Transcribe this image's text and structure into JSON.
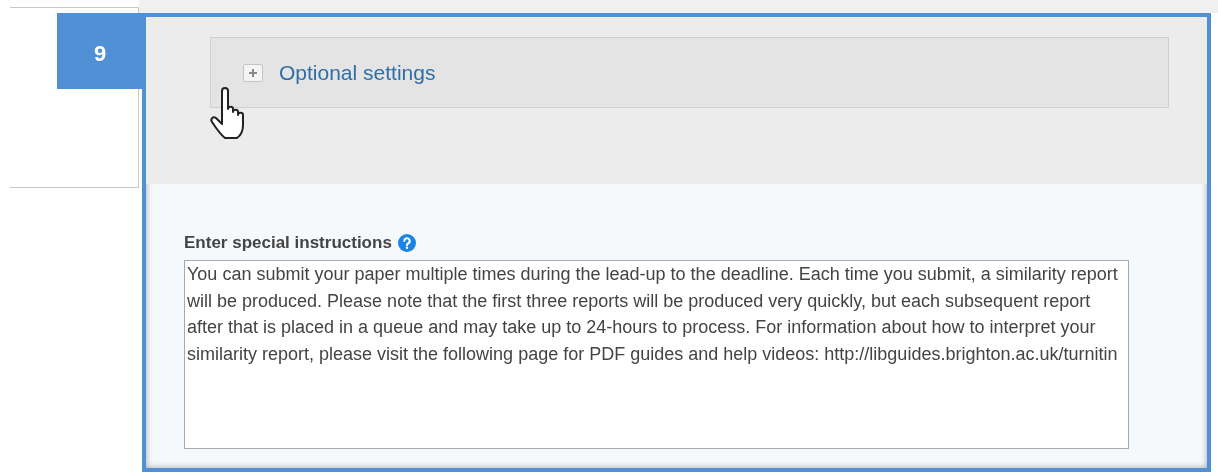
{
  "step_badge": "9",
  "optional_settings": {
    "label": "Optional settings",
    "expanded": false
  },
  "special_instructions": {
    "label": "Enter special instructions",
    "value": "You can submit your paper multiple times during the lead-up to the deadline. Each time you submit, a similarity report will be produced. Please note that the first three reports will be produced very quickly, but each subsequent report after that is placed in a queue and may take up to 24-hours to process. For information about how to interpret your similarity report, please visit the following page for PDF guides and help videos: http://libguides.brighton.ac.uk/turnitin"
  }
}
